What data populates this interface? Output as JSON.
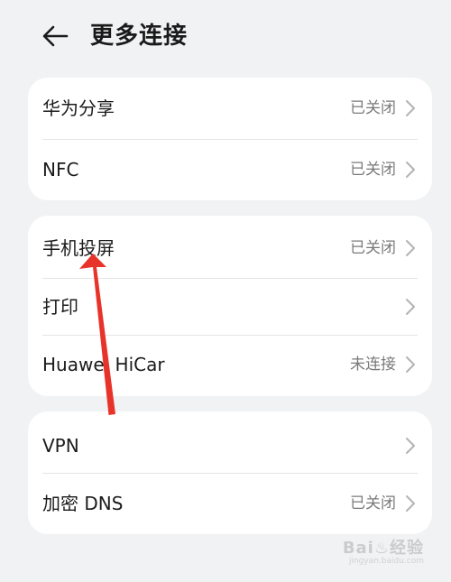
{
  "header": {
    "title": "更多连接",
    "back_icon": "arrow-left-icon"
  },
  "groups": [
    {
      "items": [
        {
          "label": "华为分享",
          "value": "已关闭"
        },
        {
          "label": "NFC",
          "value": "已关闭"
        }
      ]
    },
    {
      "items": [
        {
          "label": "手机投屏",
          "value": "已关闭"
        },
        {
          "label": "打印",
          "value": ""
        },
        {
          "label": "Huawei HiCar",
          "value": "未连接"
        }
      ]
    },
    {
      "items": [
        {
          "label": "VPN",
          "value": ""
        },
        {
          "label": "加密 DNS",
          "value": "已关闭"
        }
      ]
    }
  ],
  "annotation": {
    "color": "#e8332a",
    "icon": "red-arrow-annotation"
  },
  "watermark": {
    "main": "Bai♨经验",
    "sub": "jingyan.baidu.com"
  },
  "colors": {
    "background": "#f1f2f4",
    "card": "#ffffff",
    "secondary_text": "#7a7a7a"
  }
}
